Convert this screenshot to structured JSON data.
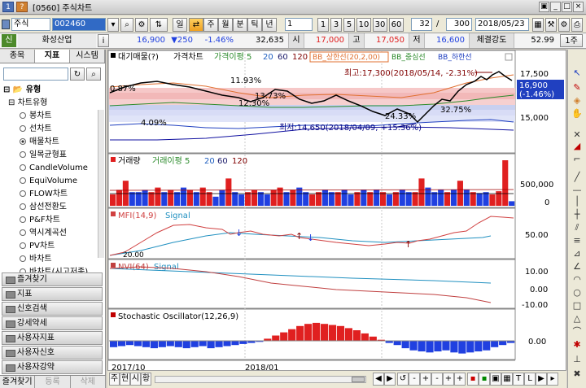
{
  "window": {
    "badge1": "1",
    "badge2": "?",
    "title": "[0560] 주식차트"
  },
  "toolbar": {
    "market": "주식",
    "code": "002460",
    "periods": [
      "일",
      "주",
      "월",
      "분",
      "틱",
      "년"
    ],
    "interval": "1",
    "quick_intervals": [
      "1",
      "3",
      "5",
      "10",
      "30",
      "60"
    ],
    "count_a": "32",
    "count_b": "300",
    "date": "2018/05/23",
    "unit": "1주"
  },
  "quote": {
    "tag": "신",
    "name": "화성산업",
    "info": "i",
    "price": "16,900",
    "change": "▼250",
    "rate": "-1.46%",
    "volume": "32,635",
    "open_label": "시",
    "open": "17,000",
    "high_label": "고",
    "high": "17,050",
    "low_label": "저",
    "low": "16,600",
    "strength_label": "체결강도",
    "strength": "52.99",
    "more": "상"
  },
  "sidebar": {
    "tabs": [
      "종목",
      "지표",
      "시스템"
    ],
    "root": "유형",
    "group": "차트유형",
    "items": [
      "봉차트",
      "선차트",
      "매물차트",
      "일목균형표",
      "CandleVolume",
      "EquiVolume",
      "FLOW차트",
      "삼선전환도",
      "P&F차트",
      "역시계곡선",
      "PV차트",
      "바차트",
      "바차트(시고저종)"
    ],
    "selected_index": 2,
    "categories": [
      "즐겨찾기",
      "지표",
      "신호검색",
      "강세약세",
      "사용자지표",
      "사용자신호",
      "사용자강약"
    ],
    "bottom_tabs": [
      "즐겨찾기",
      "등록",
      "삭제"
    ]
  },
  "chart": {
    "price_legend": [
      "대기매물(?)",
      "가격차트",
      "가격이평 5",
      "20",
      "60",
      "120",
      "BB_상한선(20,2,00)",
      "BB_중심선",
      "BB_하한선"
    ],
    "price_axis": [
      "17,500",
      "15,000"
    ],
    "last_price": "16,900",
    "last_rate": "(-1.46%)",
    "pct_labels": [
      "0.87%",
      "11.93%",
      "13.73%",
      "12.30%",
      "4.09%",
      "24.33%",
      "32.75%"
    ],
    "high_note": "최고:17,300(2018/05/14, -2.31%)",
    "low_note": "최저:14,650(2018/04/09, +15.36%)",
    "vol_legend": [
      "거래량",
      "거래이평 5",
      "20",
      "60",
      "120"
    ],
    "vol_axis": [
      "500,000",
      "0"
    ],
    "mfi_legend": [
      "MFI(14,9)",
      "Signal"
    ],
    "mfi_axis": [
      "50.00",
      "20.00"
    ],
    "nvi_legend": [
      "NVI(64)",
      "Signal"
    ],
    "nvi_axis": [
      "10.00",
      "0.00",
      "-10.00"
    ],
    "stoch_legend": "Stochastic Oscillator(12,26,9)",
    "stoch_axis": "0.00",
    "x_labels": [
      "2017/10",
      "2018/01"
    ]
  },
  "bottombar": {
    "left_buttons": [
      "주",
      "현",
      "시",
      "황"
    ],
    "right_buttons": [
      "-",
      "+",
      "-",
      "+",
      "+",
      "T",
      "L"
    ]
  },
  "colors": {
    "up": "#e02020",
    "down": "#2040e0",
    "accent": "#f0a020"
  }
}
